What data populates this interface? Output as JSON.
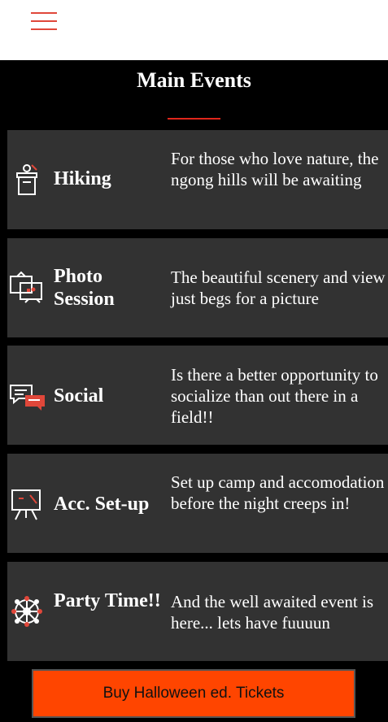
{
  "header": {
    "menu_icon": "hamburger-menu-icon"
  },
  "section": {
    "title": "Main Events"
  },
  "events": [
    {
      "icon": "lectern-icon",
      "name": "Hiking",
      "desc": "For those who love nature, the ngong hills will be awaiting"
    },
    {
      "icon": "photo-frames-icon",
      "name": "Photo Session",
      "desc": "The beautiful scenery and view just begs for a picture"
    },
    {
      "icon": "chat-bubbles-icon",
      "name": "Social",
      "desc": "Is there a better opportunity to socialize than out there in a field!!"
    },
    {
      "icon": "presentation-easel-icon",
      "name": "Acc. Set-up",
      "desc": "Set up camp and accomodation before the night creeps in!"
    },
    {
      "icon": "network-wheel-icon",
      "name": "Party Time!!",
      "desc": "And the well awaited event is here... lets have fuuuun"
    }
  ],
  "cta": {
    "label": "Buy Halloween ed. Tickets"
  },
  "colors": {
    "accent": "#e0261b",
    "cta_bg": "#ff4500",
    "card_bg": "#323232",
    "page_bg": "#000000"
  }
}
